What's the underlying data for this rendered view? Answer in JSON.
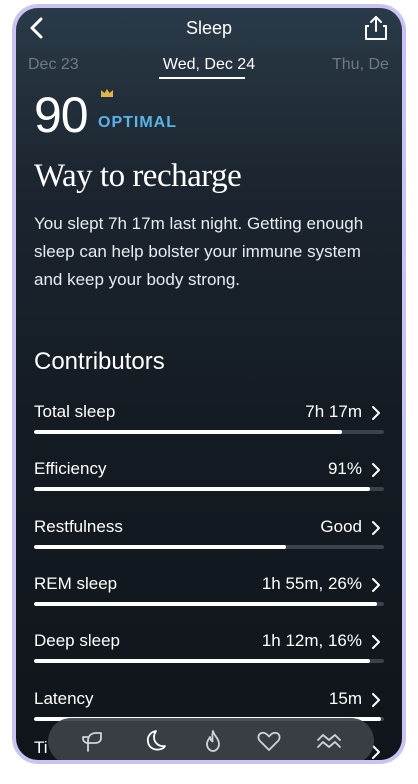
{
  "header": {
    "title": "Sleep"
  },
  "dates": {
    "previous": "Dec 23",
    "current": "Wed, Dec 24",
    "next": "Thu, De"
  },
  "score": {
    "value": "90",
    "status": "OPTIMAL"
  },
  "summary": {
    "headline": "Way to recharge",
    "body": "You slept 7h 17m last night. Getting enough sleep can help bolster your immune system and keep your body strong."
  },
  "contributors": {
    "title": "Contributors",
    "items": [
      {
        "label": "Total sleep",
        "value": "7h 17m",
        "level": 0.88
      },
      {
        "label": "Efficiency",
        "value": "91%",
        "level": 0.96
      },
      {
        "label": "Restfulness",
        "value": "Good",
        "level": 0.72
      },
      {
        "label": "REM sleep",
        "value": "1h 55m, 26%",
        "level": 0.98
      },
      {
        "label": "Deep sleep",
        "value": "1h 12m, 16%",
        "level": 0.96
      },
      {
        "label": "Latency",
        "value": "15m",
        "level": 0.99
      }
    ],
    "partial_label": "Ti"
  },
  "bottom_nav": {
    "items": [
      "readiness-icon",
      "sleep-icon",
      "activity-icon",
      "heart-icon",
      "trends-icon"
    ]
  },
  "colors": {
    "accent": "#5ab4e8",
    "crown": "#e0b446",
    "background": "#141b22",
    "frame": "#c9c3f2"
  }
}
